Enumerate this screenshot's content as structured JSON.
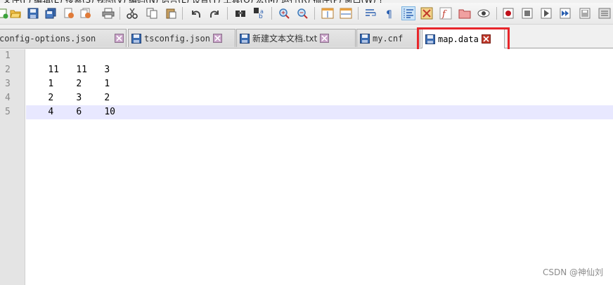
{
  "tabs": [
    {
      "label": "config-options.json",
      "active": false
    },
    {
      "label": "tsconfig.json",
      "active": false
    },
    {
      "label": "新建文本文档.txt",
      "active": false
    },
    {
      "label": "my.cnf",
      "active": false
    },
    {
      "label": "map.data",
      "active": true
    }
  ],
  "editor": {
    "line_numbers": [
      "1",
      "2",
      "3",
      "4",
      "5"
    ],
    "lines": [
      [
        "11",
        "11",
        "3"
      ],
      [
        "1",
        "2",
        "1"
      ],
      [
        "2",
        "3",
        "2"
      ],
      [
        "4",
        "6",
        "10"
      ],
      []
    ],
    "current_line": 5
  },
  "watermark": "CSDN @神仙刘",
  "colors": {
    "highlight_box": "#e8262b",
    "active_tab_accent": "#f5a623",
    "current_line_bg": "#e8e8ff",
    "gutter_bg": "#e4e4e4"
  },
  "toolbar_icons": [
    "new-file-icon",
    "open-file-icon",
    "save-icon",
    "save-all-icon",
    "close-icon",
    "close-all-icon",
    "print-icon",
    "cut-icon",
    "copy-icon",
    "paste-icon",
    "undo-icon",
    "redo-icon",
    "find-icon",
    "replace-icon",
    "zoom-in-icon",
    "zoom-out-icon",
    "sync-vertical-icon",
    "sync-horizontal-icon",
    "word-wrap-icon",
    "show-all-chars-icon",
    "indent-guide-icon",
    "language-icon",
    "function-list-icon",
    "folder-workspace-icon",
    "monitoring-icon",
    "record-macro-icon",
    "stop-record-icon",
    "play-macro-icon",
    "run-macro-multiple-icon",
    "save-macro-icon"
  ]
}
